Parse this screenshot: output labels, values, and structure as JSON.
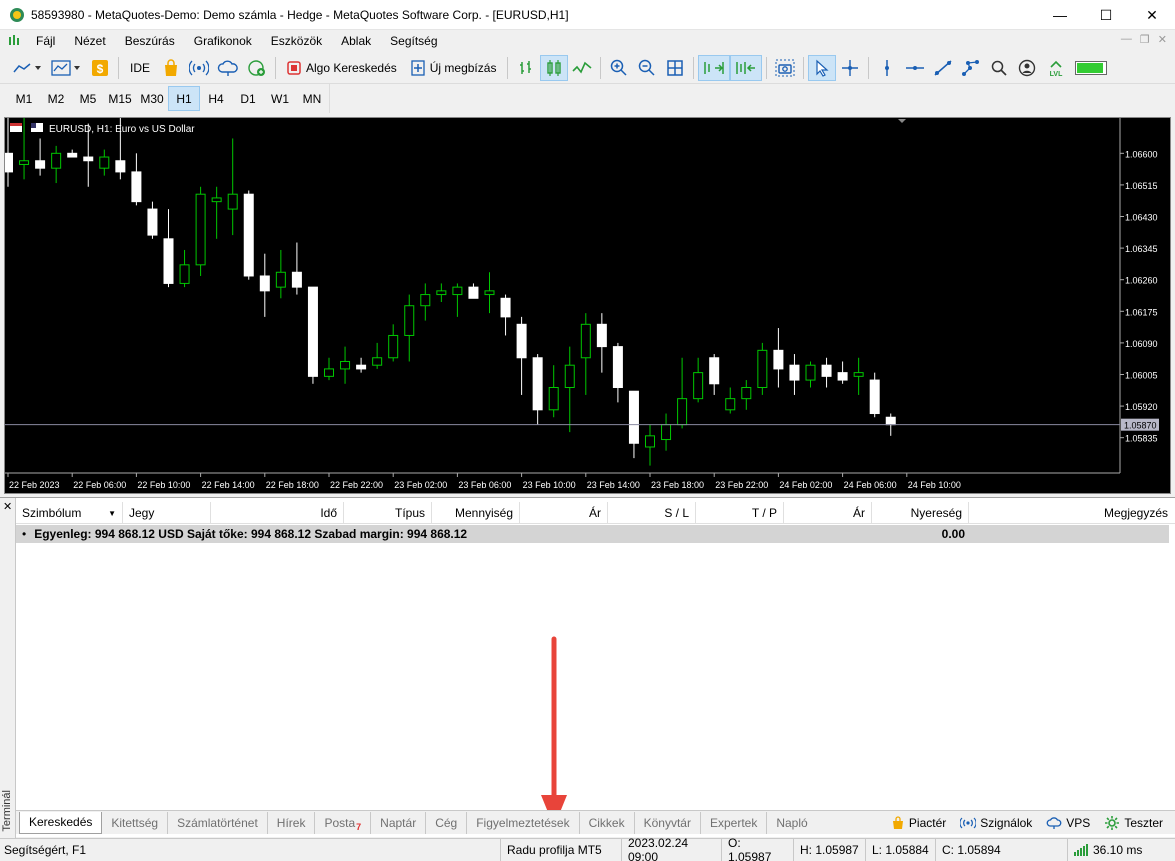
{
  "window": {
    "title": "58593980 - MetaQuotes-Demo: Demo számla - Hedge - MetaQuotes Software Corp. - [EURUSD,H1]",
    "minimize": "—",
    "maximize": "☐",
    "close": "✕"
  },
  "menu": [
    "Fájl",
    "Nézet",
    "Beszúrás",
    "Grafikonok",
    "Eszközök",
    "Ablak",
    "Segítség"
  ],
  "toolbar": {
    "ide": "IDE",
    "algo": "Algo Kereskedés",
    "new_order": "Új megbízás"
  },
  "timeframes": [
    "M1",
    "M5",
    "M15",
    "M30",
    "H1",
    "H4",
    "D1",
    "W1",
    "MN"
  ],
  "timeframes_full": [
    "M1",
    "M2",
    "M5",
    "M15",
    "M30",
    "H1",
    "H4",
    "D1",
    "W1",
    "MN"
  ],
  "active_timeframe": "H1",
  "chart": {
    "header": "EURUSD, H1:  Euro vs US Dollar",
    "current_price": "1.05870",
    "price_labels": [
      "1.06600",
      "1.06515",
      "1.06430",
      "1.06345",
      "1.06260",
      "1.06175",
      "1.06090",
      "1.06005",
      "1.05920",
      "1.05835"
    ],
    "time_labels": [
      "22 Feb 2023",
      "22 Feb 06:00",
      "22 Feb 10:00",
      "22 Feb 14:00",
      "22 Feb 18:00",
      "22 Feb 22:00",
      "23 Feb 02:00",
      "23 Feb 06:00",
      "23 Feb 10:00",
      "23 Feb 14:00",
      "23 Feb 18:00",
      "23 Feb 22:00",
      "24 Feb 02:00",
      "24 Feb 06:00",
      "24 Feb 10:00"
    ],
    "bull_color": "#00c800",
    "bear_color": "#ffffff",
    "candles": [
      {
        "o": 1.066,
        "h": 1.067,
        "l": 1.0651,
        "c": 1.0655
      },
      {
        "o": 1.0657,
        "h": 1.0672,
        "l": 1.0653,
        "c": 1.0658
      },
      {
        "o": 1.0658,
        "h": 1.0664,
        "l": 1.0654,
        "c": 1.0656
      },
      {
        "o": 1.0656,
        "h": 1.0662,
        "l": 1.0652,
        "c": 1.066
      },
      {
        "o": 1.066,
        "h": 1.0661,
        "l": 1.0659,
        "c": 1.0659
      },
      {
        "o": 1.0659,
        "h": 1.0668,
        "l": 1.0651,
        "c": 1.0658
      },
      {
        "o": 1.0656,
        "h": 1.0661,
        "l": 1.0654,
        "c": 1.0659
      },
      {
        "o": 1.0658,
        "h": 1.067,
        "l": 1.0653,
        "c": 1.0655
      },
      {
        "o": 1.0655,
        "h": 1.066,
        "l": 1.0646,
        "c": 1.0647
      },
      {
        "o": 1.0645,
        "h": 1.0647,
        "l": 1.0637,
        "c": 1.0638
      },
      {
        "o": 1.0637,
        "h": 1.0645,
        "l": 1.0624,
        "c": 1.0625
      },
      {
        "o": 1.0625,
        "h": 1.0634,
        "l": 1.0624,
        "c": 1.063
      },
      {
        "o": 1.063,
        "h": 1.0651,
        "l": 1.0627,
        "c": 1.0649
      },
      {
        "o": 1.0647,
        "h": 1.0651,
        "l": 1.0637,
        "c": 1.0648
      },
      {
        "o": 1.0645,
        "h": 1.0664,
        "l": 1.0638,
        "c": 1.0649
      },
      {
        "o": 1.0649,
        "h": 1.065,
        "l": 1.0626,
        "c": 1.0627
      },
      {
        "o": 1.0627,
        "h": 1.0633,
        "l": 1.0616,
        "c": 1.0623
      },
      {
        "o": 1.0624,
        "h": 1.0634,
        "l": 1.0621,
        "c": 1.0628
      },
      {
        "o": 1.0628,
        "h": 1.0636,
        "l": 1.0622,
        "c": 1.0624
      },
      {
        "o": 1.0624,
        "h": 1.0624,
        "l": 1.0598,
        "c": 1.06
      },
      {
        "o": 1.06,
        "h": 1.0605,
        "l": 1.0599,
        "c": 1.0602
      },
      {
        "o": 1.0602,
        "h": 1.0608,
        "l": 1.0598,
        "c": 1.0604
      },
      {
        "o": 1.0603,
        "h": 1.0605,
        "l": 1.0601,
        "c": 1.0602
      },
      {
        "o": 1.0603,
        "h": 1.0609,
        "l": 1.0602,
        "c": 1.0605
      },
      {
        "o": 1.0605,
        "h": 1.0614,
        "l": 1.0604,
        "c": 1.0611
      },
      {
        "o": 1.0611,
        "h": 1.0622,
        "l": 1.0604,
        "c": 1.0619
      },
      {
        "o": 1.0619,
        "h": 1.0625,
        "l": 1.0615,
        "c": 1.0622
      },
      {
        "o": 1.0622,
        "h": 1.0625,
        "l": 1.062,
        "c": 1.0623
      },
      {
        "o": 1.0622,
        "h": 1.0625,
        "l": 1.0616,
        "c": 1.0624
      },
      {
        "o": 1.0624,
        "h": 1.0625,
        "l": 1.0621,
        "c": 1.0621
      },
      {
        "o": 1.0622,
        "h": 1.0628,
        "l": 1.0617,
        "c": 1.0623
      },
      {
        "o": 1.0621,
        "h": 1.0622,
        "l": 1.0611,
        "c": 1.0616
      },
      {
        "o": 1.0614,
        "h": 1.0616,
        "l": 1.0595,
        "c": 1.0605
      },
      {
        "o": 1.0605,
        "h": 1.0606,
        "l": 1.0587,
        "c": 1.0591
      },
      {
        "o": 1.0591,
        "h": 1.0603,
        "l": 1.0589,
        "c": 1.0597
      },
      {
        "o": 1.0597,
        "h": 1.0608,
        "l": 1.0585,
        "c": 1.0603
      },
      {
        "o": 1.0605,
        "h": 1.0617,
        "l": 1.0595,
        "c": 1.0614
      },
      {
        "o": 1.0614,
        "h": 1.0617,
        "l": 1.0601,
        "c": 1.0608
      },
      {
        "o": 1.0608,
        "h": 1.0609,
        "l": 1.0593,
        "c": 1.0597
      },
      {
        "o": 1.0596,
        "h": 1.0596,
        "l": 1.0578,
        "c": 1.0582
      },
      {
        "o": 1.0581,
        "h": 1.0587,
        "l": 1.0576,
        "c": 1.0584
      },
      {
        "o": 1.0583,
        "h": 1.059,
        "l": 1.058,
        "c": 1.0587
      },
      {
        "o": 1.0587,
        "h": 1.0605,
        "l": 1.0586,
        "c": 1.0594
      },
      {
        "o": 1.0594,
        "h": 1.0605,
        "l": 1.0593,
        "c": 1.0601
      },
      {
        "o": 1.0605,
        "h": 1.0606,
        "l": 1.0595,
        "c": 1.0598
      },
      {
        "o": 1.0591,
        "h": 1.0597,
        "l": 1.059,
        "c": 1.0594
      },
      {
        "o": 1.0594,
        "h": 1.0599,
        "l": 1.0591,
        "c": 1.0597
      },
      {
        "o": 1.0597,
        "h": 1.0609,
        "l": 1.0595,
        "c": 1.0607
      },
      {
        "o": 1.0607,
        "h": 1.0613,
        "l": 1.0597,
        "c": 1.0602
      },
      {
        "o": 1.0603,
        "h": 1.0606,
        "l": 1.0595,
        "c": 1.0599
      },
      {
        "o": 1.0599,
        "h": 1.0604,
        "l": 1.0597,
        "c": 1.0603
      },
      {
        "o": 1.0603,
        "h": 1.0605,
        "l": 1.0597,
        "c": 1.06
      },
      {
        "o": 1.0601,
        "h": 1.0604,
        "l": 1.0598,
        "c": 1.0599
      },
      {
        "o": 1.06,
        "h": 1.0605,
        "l": 1.0595,
        "c": 1.0601
      },
      {
        "o": 1.0599,
        "h": 1.0601,
        "l": 1.0589,
        "c": 1.059
      },
      {
        "o": 1.0589,
        "h": 1.059,
        "l": 1.0584,
        "c": 1.0587
      }
    ]
  },
  "terminal": {
    "side_label": "Terminál",
    "columns": [
      "Szimbólum",
      "Jegy",
      "Idő",
      "Típus",
      "Mennyiség",
      "Ár",
      "S / L",
      "T / P",
      "Ár",
      "Nyereség",
      "Megjegyzés"
    ],
    "balance_text": "Egyenleg: 994 868.12 USD  Saját tőke: 994 868.12  Szabad margin: 994 868.12",
    "profit": "0.00",
    "tabs": [
      {
        "label": "Kereskedés"
      },
      {
        "label": "Kitettség"
      },
      {
        "label": "Számlatörténet"
      },
      {
        "label": "Hírek"
      },
      {
        "label": "Posta",
        "badge": "7"
      },
      {
        "label": "Naptár"
      },
      {
        "label": "Cég"
      },
      {
        "label": "Figyelmeztetések"
      },
      {
        "label": "Cikkek"
      },
      {
        "label": "Könyvtár"
      },
      {
        "label": "Expertek"
      },
      {
        "label": "Napló"
      }
    ],
    "right_tabs": [
      "Piactér",
      "Szignálok",
      "VPS",
      "Teszter"
    ]
  },
  "status": {
    "help": "Segítségért, F1",
    "profile": "Radu profilja MT5",
    "datetime": "2023.02.24 09:00",
    "open": "O: 1.05987",
    "high": "H: 1.05987",
    "low": "L: 1.05884",
    "close": "C: 1.05894",
    "ping": "36.10 ms"
  },
  "colors": {
    "annotation_arrow": "#e8443a",
    "chart_bg": "#000000",
    "accent": "#cce4f7"
  }
}
